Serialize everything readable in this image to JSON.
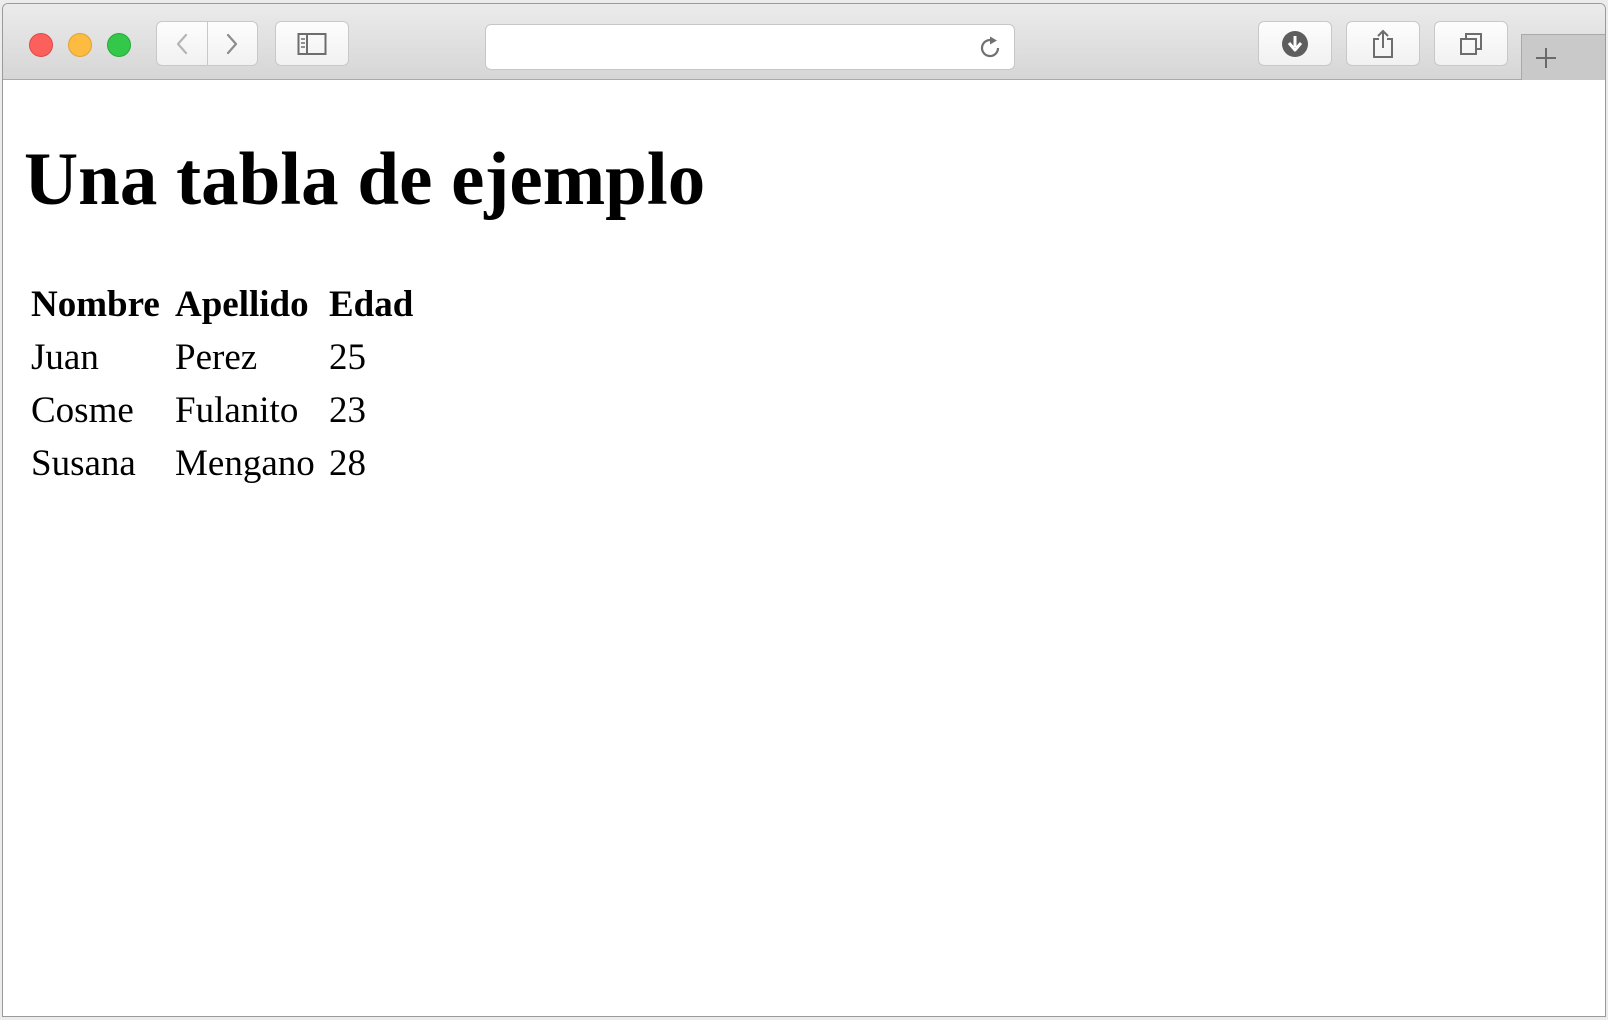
{
  "browser": {
    "address_value": "",
    "icons": {
      "back": "chevron-left-icon",
      "forward": "chevron-right-icon",
      "sidebar": "sidebar-icon",
      "reload": "reload-icon",
      "downloads": "download-icon",
      "share": "share-icon",
      "tabs": "tabs-icon",
      "new_tab": "plus-icon"
    },
    "colors": {
      "close": "#fc605c",
      "minimize": "#fdbc40",
      "zoom": "#34c84a"
    }
  },
  "page": {
    "title": "Una tabla de ejemplo",
    "table": {
      "headers": [
        "Nombre",
        "Apellido",
        "Edad"
      ],
      "rows": [
        [
          "Juan",
          "Perez",
          "25"
        ],
        [
          "Cosme",
          "Fulanito",
          "23"
        ],
        [
          "Susana",
          "Mengano",
          "28"
        ]
      ]
    }
  }
}
